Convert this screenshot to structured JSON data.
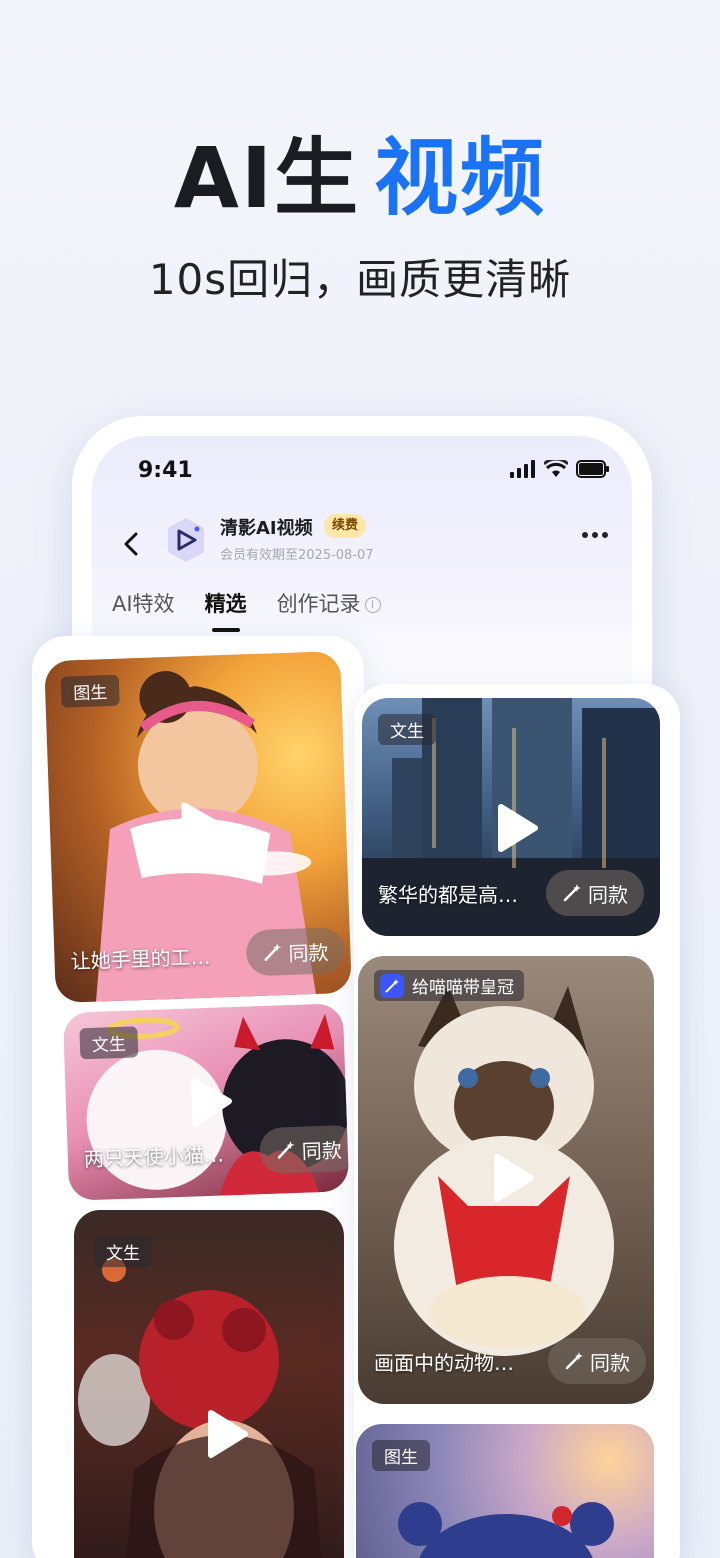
{
  "headline": {
    "part1": "AI生",
    "part2": "视频"
  },
  "subtitle": "10s回归，画质更清晰",
  "status": {
    "time": "9:41"
  },
  "nav": {
    "app_name": "清影AI视频",
    "renew": "续费",
    "member_text": "会员有效期至2025-08-07"
  },
  "tabs": [
    {
      "label": "AI特效",
      "active": false
    },
    {
      "label": "精选",
      "active": true
    },
    {
      "label": "创作记录",
      "active": false
    }
  ],
  "cards": {
    "left1": {
      "tag": "图生",
      "caption": "让她手里的工…",
      "action": "同款"
    },
    "left2": {
      "tag": "文生",
      "caption": "两只天使小猫…",
      "action": "同款"
    },
    "left3": {
      "tag": "文生"
    },
    "right1": {
      "tag": "文生",
      "caption": "繁华的都是高…",
      "action": "同款"
    },
    "right2": {
      "tag": "给喵喵带皇冠",
      "caption": "画面中的动物…",
      "action": "同款"
    },
    "right3": {
      "tag": "图生"
    }
  },
  "colors": {
    "accent": "#1a73f5",
    "renew_bg": "#fde7a8"
  }
}
